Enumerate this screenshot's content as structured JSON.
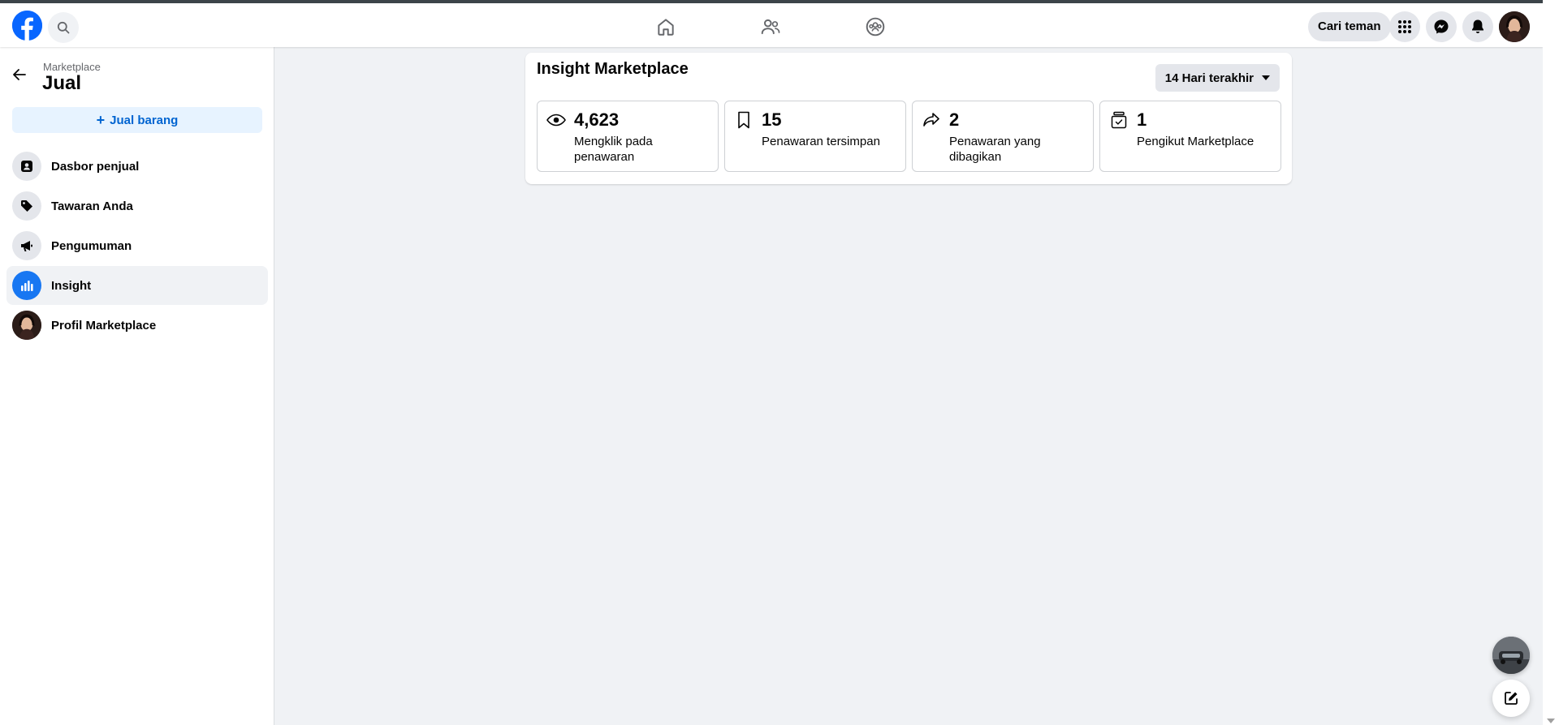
{
  "topbar": {
    "logo_icon": "facebook-logo-icon",
    "search_icon": "search-icon",
    "nav_icons": [
      "home-icon",
      "friends-icon",
      "groups-icon"
    ],
    "find_friends_label": "Cari teman",
    "menu_icon": "grid-menu-icon",
    "messenger_icon": "messenger-icon",
    "notifications_icon": "bell-icon"
  },
  "sidebar": {
    "breadcrumb": "Marketplace",
    "title": "Jual",
    "sell_button": "Jual barang",
    "items": [
      {
        "label": "Dasbor penjual",
        "icon": "seller-dashboard-icon",
        "active": false
      },
      {
        "label": "Tawaran Anda",
        "icon": "tag-icon",
        "active": false
      },
      {
        "label": "Pengumuman",
        "icon": "megaphone-icon",
        "active": false
      },
      {
        "label": "Insight",
        "icon": "bar-chart-icon",
        "active": true
      },
      {
        "label": "Profil Marketplace",
        "icon": "profile-avatar",
        "active": false
      }
    ]
  },
  "main": {
    "title": "Insight Marketplace",
    "range_label": "14 Hari terakhir",
    "stats": [
      {
        "value": "4,623",
        "label": "Mengklik pada penawaran",
        "icon": "eye-icon"
      },
      {
        "value": "15",
        "label": "Penawaran tersimpan",
        "icon": "bookmark-icon"
      },
      {
        "value": "2",
        "label": "Penawaran yang dibagikan",
        "icon": "share-icon"
      },
      {
        "value": "1",
        "label": "Pengikut Marketplace",
        "icon": "follower-jar-icon"
      }
    ]
  },
  "colors": {
    "brand": "#0866ff",
    "accent_blue": "#1877f2",
    "background": "#f0f2f5",
    "button_gray": "#e4e6eb"
  }
}
